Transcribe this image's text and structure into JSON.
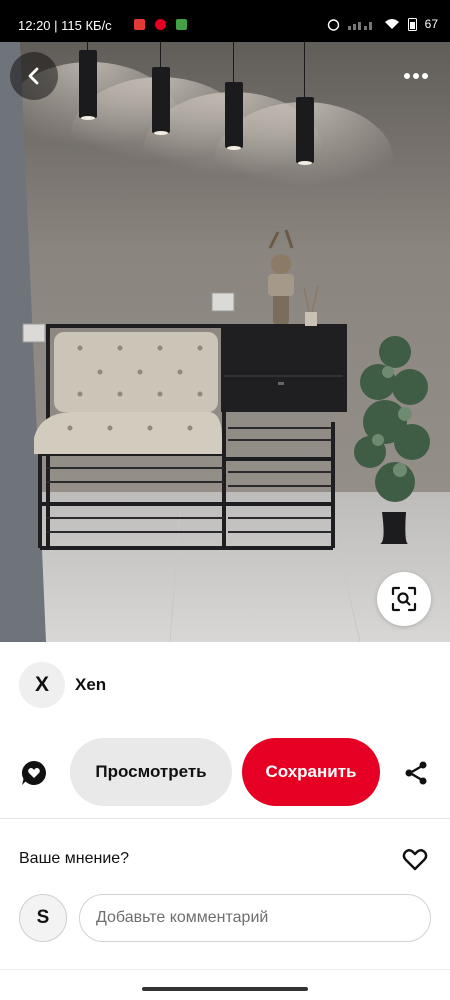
{
  "status_bar": {
    "time_speed": "12:20 | 115 КБ/с",
    "battery": "67"
  },
  "photo": {
    "back_icon": "chevron-left-icon",
    "more_icon": "more-horizontal-icon",
    "lens_icon": "visual-search-icon"
  },
  "creator": {
    "avatar_letter": "X",
    "name": "Xen"
  },
  "actions": {
    "view_label": "Просмотреть",
    "save_label": "Сохранить",
    "save_color": "#e60023"
  },
  "comments": {
    "prompt": "Ваше мнение?",
    "user_initial": "S",
    "placeholder": "Добавьте комментарий"
  }
}
